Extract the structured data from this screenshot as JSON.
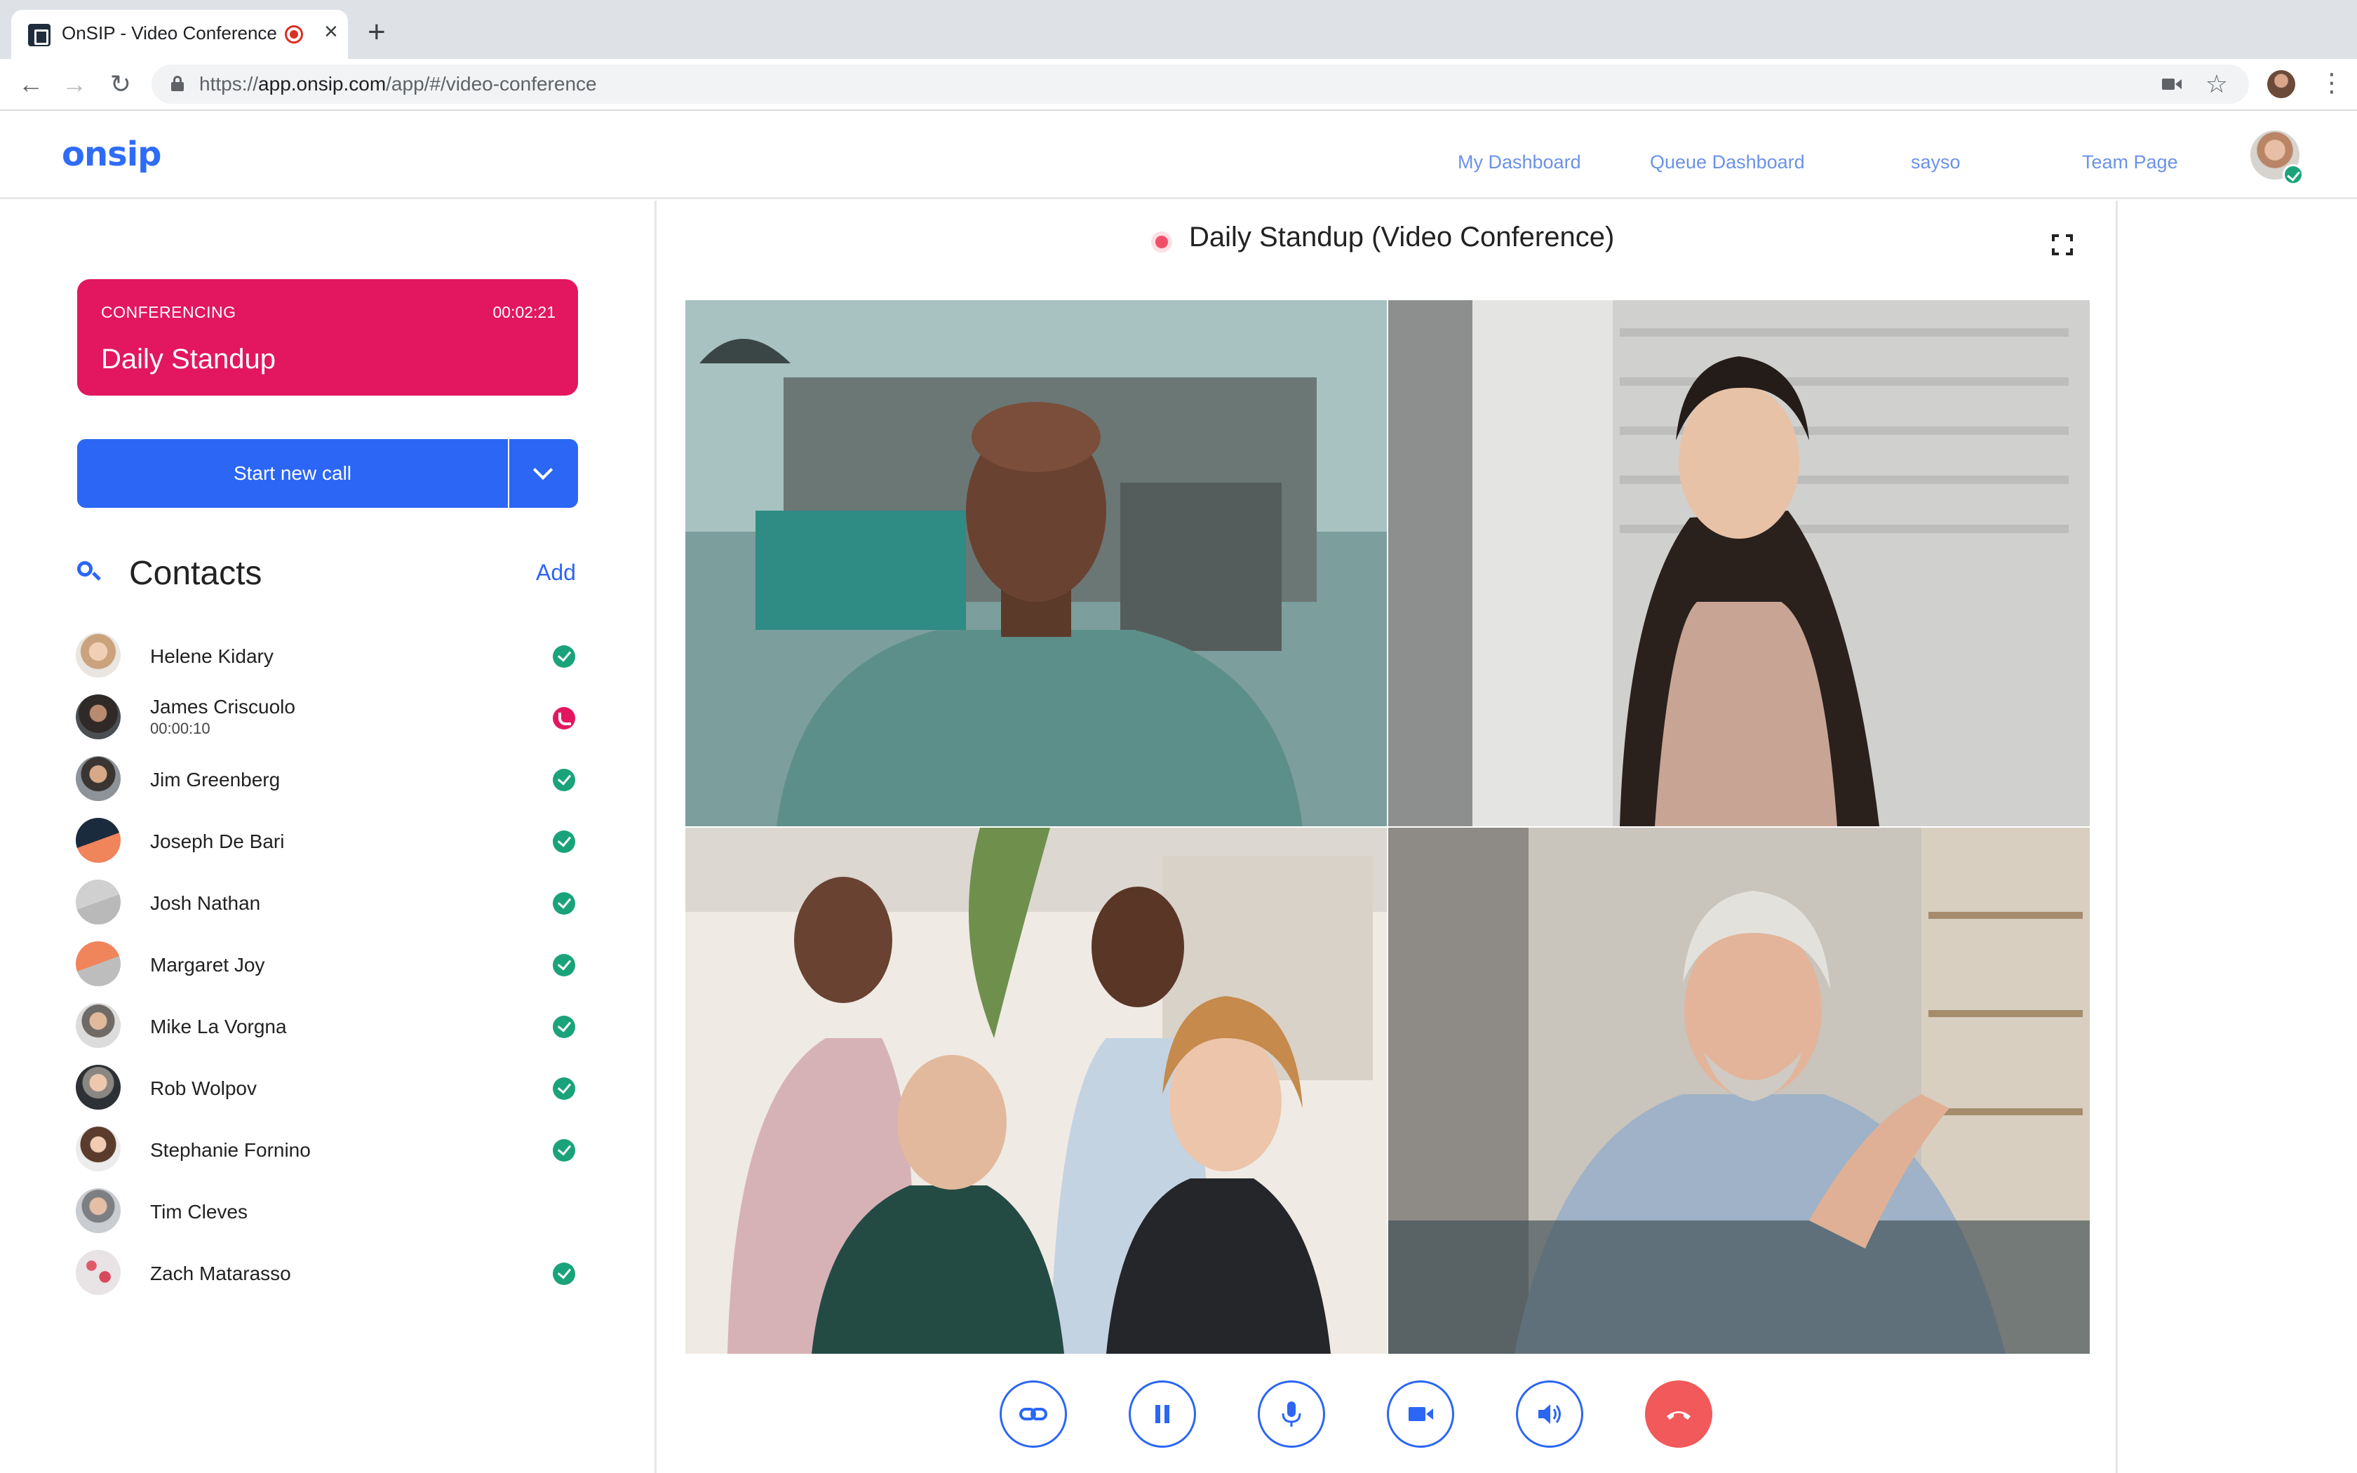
{
  "browser": {
    "tab_title": "OnSIP - Video Conference",
    "url_scheme": "https://",
    "url_host": "app.onsip.com",
    "url_path": "/app/#/video-conference"
  },
  "header": {
    "logo": "onsip",
    "nav": [
      "My Dashboard",
      "Queue Dashboard",
      "sayso",
      "Team Page"
    ]
  },
  "conference_card": {
    "status": "CONFERENCING",
    "timer": "00:02:21",
    "name": "Daily Standup"
  },
  "start_call_label": "Start new call",
  "contacts": {
    "title": "Contacts",
    "add_label": "Add",
    "items": [
      {
        "name": "Helene Kidary",
        "sub": "",
        "status": "available"
      },
      {
        "name": "James Criscuolo",
        "sub": "00:00:10",
        "status": "on-call"
      },
      {
        "name": "Jim Greenberg",
        "sub": "",
        "status": "available"
      },
      {
        "name": "Joseph De Bari",
        "sub": "",
        "status": "available"
      },
      {
        "name": "Josh Nathan",
        "sub": "",
        "status": "available"
      },
      {
        "name": "Margaret Joy",
        "sub": "",
        "status": "available"
      },
      {
        "name": "Mike La Vorgna",
        "sub": "",
        "status": "available"
      },
      {
        "name": "Rob Wolpov",
        "sub": "",
        "status": "available"
      },
      {
        "name": "Stephanie Fornino",
        "sub": "",
        "status": "available"
      },
      {
        "name": "Tim Cleves",
        "sub": "",
        "status": "none"
      },
      {
        "name": "Zach Matarasso",
        "sub": "",
        "status": "available"
      }
    ]
  },
  "conference": {
    "title": "Daily Standup (Video Conference)"
  },
  "controls": [
    "link-icon",
    "pause-icon",
    "microphone-icon",
    "video-camera-icon",
    "speaker-icon",
    "hangup-icon"
  ],
  "colors": {
    "brand": "#2f6cf6",
    "primary": "#2b66f5",
    "conferencing": "#e2175f",
    "available": "#1aa37a",
    "hangup": "#f2595a"
  }
}
